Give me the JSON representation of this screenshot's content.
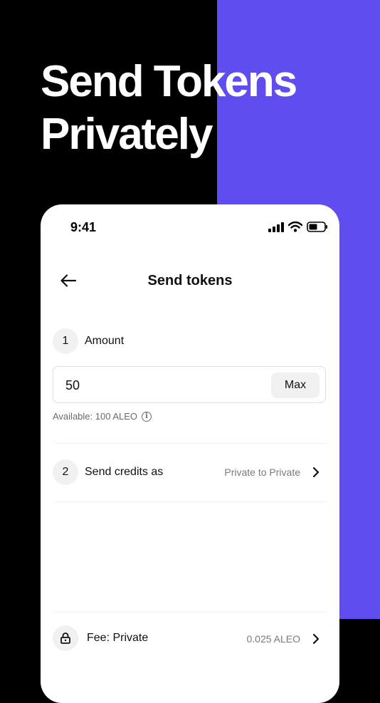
{
  "promo": {
    "headline_line1": "Send Tokens",
    "headline_line2": "Privately"
  },
  "colors": {
    "background": "#000000",
    "accent_panel": "#5f4df0",
    "card": "#ffffff",
    "muted_text": "#7a7a7a",
    "chip_bg": "#f1f1f1"
  },
  "status_bar": {
    "time": "9:41",
    "icons": [
      "cellular-signal-icon",
      "wifi-icon",
      "battery-icon"
    ]
  },
  "header": {
    "back_icon": "arrow-left-icon",
    "title": "Send tokens"
  },
  "amount_step": {
    "number": "1",
    "label": "Amount",
    "value": "50",
    "max_label": "Max",
    "available": "Available: 100 ALEO",
    "info_icon": "info-icon"
  },
  "credits_step": {
    "number": "2",
    "label": "Send credits as",
    "value": "Private to Private",
    "chevron_icon": "chevron-right-icon"
  },
  "fee": {
    "icon": "lock-icon",
    "label": "Fee: Private",
    "value": "0.025 ALEO",
    "chevron_icon": "chevron-right-icon"
  }
}
